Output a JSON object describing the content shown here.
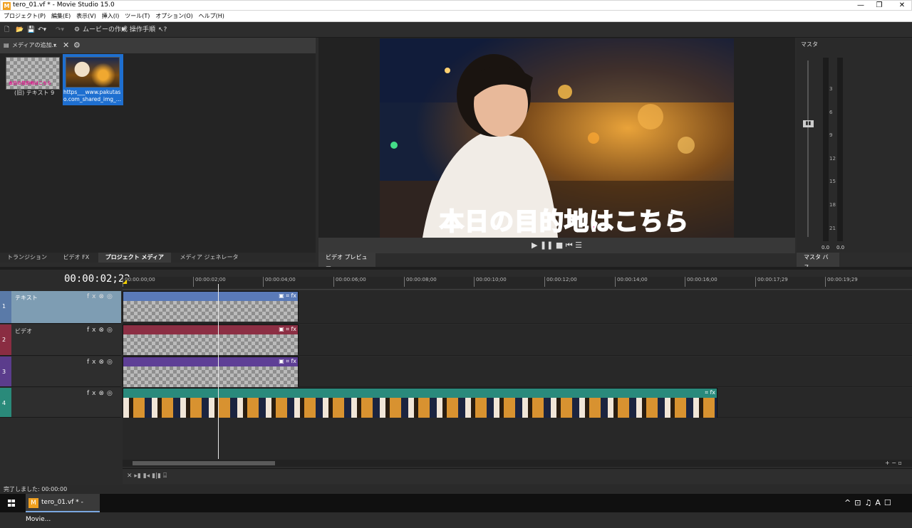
{
  "window": {
    "title": "tero_01.vf * - Movie Studio 15.0",
    "app_icon": "M",
    "controls": [
      "—",
      "❐",
      "✕"
    ]
  },
  "menu": [
    "プロジェクト(P)",
    "編集(E)",
    "表示(V)",
    "挿入(I)",
    "ツール(T)",
    "オプション(O)",
    "ヘルプ(H)"
  ],
  "toolbar": {
    "make_movie": "ムービーの作成",
    "guide": "操作手順"
  },
  "media_panel": {
    "dropdown": "メディアの追加...",
    "items": [
      {
        "label": "(旧) テキスト 9",
        "thumb_text": "本日の目的地はこちら"
      },
      {
        "label": "https___www.pakutas o.com_shared_img_..."
      }
    ],
    "tabs": [
      "トランジション",
      "ビデオ FX",
      "プロジェクト メディア",
      "メディア ジェネレータ"
    ],
    "active_tab": 2
  },
  "preview": {
    "caption": "本日の目的地はこちら",
    "tab": "ビデオ プレビュー",
    "controls": [
      "▶",
      "❚❚",
      "■",
      "⏮",
      "☰"
    ]
  },
  "master": {
    "title": "マスタ",
    "scale": [
      "3",
      "6",
      "9",
      "12",
      "15",
      "18",
      "21"
    ],
    "readout_left": "0.0",
    "readout_right": "0.0",
    "tab": "マスタ バス"
  },
  "timeline": {
    "timecode": "00:00:02;22",
    "ruler": [
      "00:00:00;00",
      "00:00:02;00",
      "00:00:04;00",
      "00:00:06;00",
      "00:00:08;00",
      "00:00:10;00",
      "00:00:12;00",
      "00:00:14;00",
      "00:00:16;00",
      "00:00:17;29",
      "00:00:19;29"
    ],
    "tracks": [
      {
        "num": "1",
        "name": "テキスト",
        "color": "#6f93b6",
        "clip_color": "#5a7ab8"
      },
      {
        "num": "2",
        "name": "ビデオ",
        "color": "#8a2d42",
        "clip_color": "#8c2f44"
      },
      {
        "num": "3",
        "name": "",
        "color": "#5b3c8c",
        "clip_color": "#5e3f96"
      },
      {
        "num": "4",
        "name": "",
        "color": "#2a8a7a",
        "clip_color": "#2a8a7c"
      }
    ],
    "track_icons": [
      "fx",
      "⊗",
      "◎"
    ]
  },
  "status": "完了しました: 00:00:00",
  "taskbar": {
    "item": "tero_01.vf * - Movie...",
    "tray": [
      "^",
      "⊡",
      "♫",
      "A",
      "☐"
    ]
  }
}
